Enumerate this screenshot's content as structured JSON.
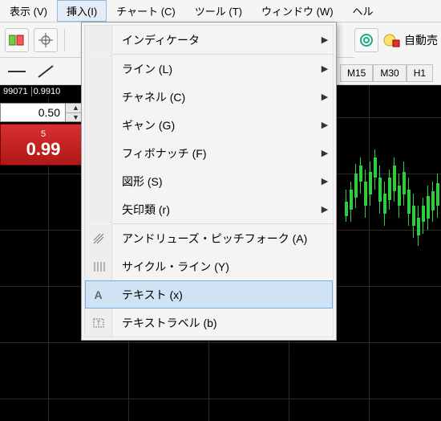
{
  "menubar": {
    "view": "表示 (V)",
    "insert": "挿入(I)",
    "chart": "チャート (C)",
    "tools": "ツール (T)",
    "window": "ウィンドウ (W)",
    "help": "ヘル"
  },
  "toolbar": {
    "auto_label": "自動売"
  },
  "timeframes": {
    "m15": "M15",
    "m30": "M30",
    "h1": "H1"
  },
  "price_scale": {
    "a": "99071",
    "b": "0.9910"
  },
  "trade": {
    "qty": "0.50",
    "sell_top": "5",
    "sell_big": "0.99"
  },
  "dropdown": {
    "indicators": "インディケータ",
    "lines": "ライン (L)",
    "channels": "チャネル (C)",
    "gann": "ギャン (G)",
    "fibonacci": "フィボナッチ (F)",
    "shapes": "図形 (S)",
    "arrows": "矢印類 (r)",
    "pitchfork": "アンドリューズ・ピッチフォーク (A)",
    "cycle": "サイクル・ライン (Y)",
    "text": "テキスト (x)",
    "textlabel": "テキストラベル (b)"
  }
}
